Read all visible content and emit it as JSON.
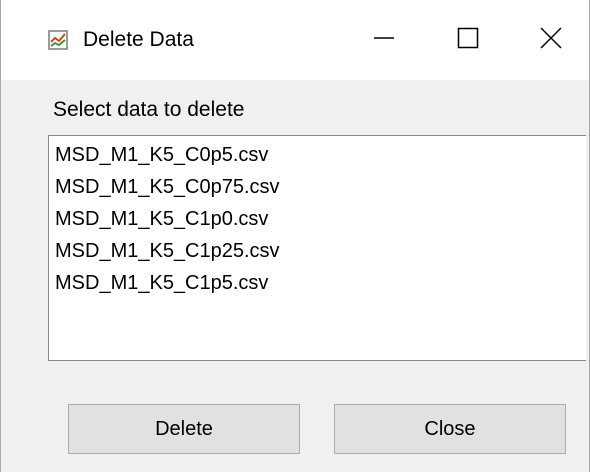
{
  "window": {
    "title": "Delete Data",
    "app_icon": "chart-app-icon",
    "controls": {
      "minimize_icon": "minimize-icon",
      "maximize_icon": "maximize-icon",
      "close_icon": "close-icon"
    }
  },
  "dialog": {
    "prompt": "Select data to delete",
    "files": [
      "MSD_M1_K5_C0p5.csv",
      "MSD_M1_K5_C0p75.csv",
      "MSD_M1_K5_C1p0.csv",
      "MSD_M1_K5_C1p25.csv",
      "MSD_M1_K5_C1p5.csv"
    ],
    "buttons": {
      "delete_label": "Delete",
      "close_label": "Close"
    }
  },
  "colors": {
    "window_background": "#f0f0f0",
    "titlebar_background": "#ffffff",
    "list_background": "#ffffff",
    "button_face": "#e1e1e1",
    "button_border": "#adadad"
  }
}
